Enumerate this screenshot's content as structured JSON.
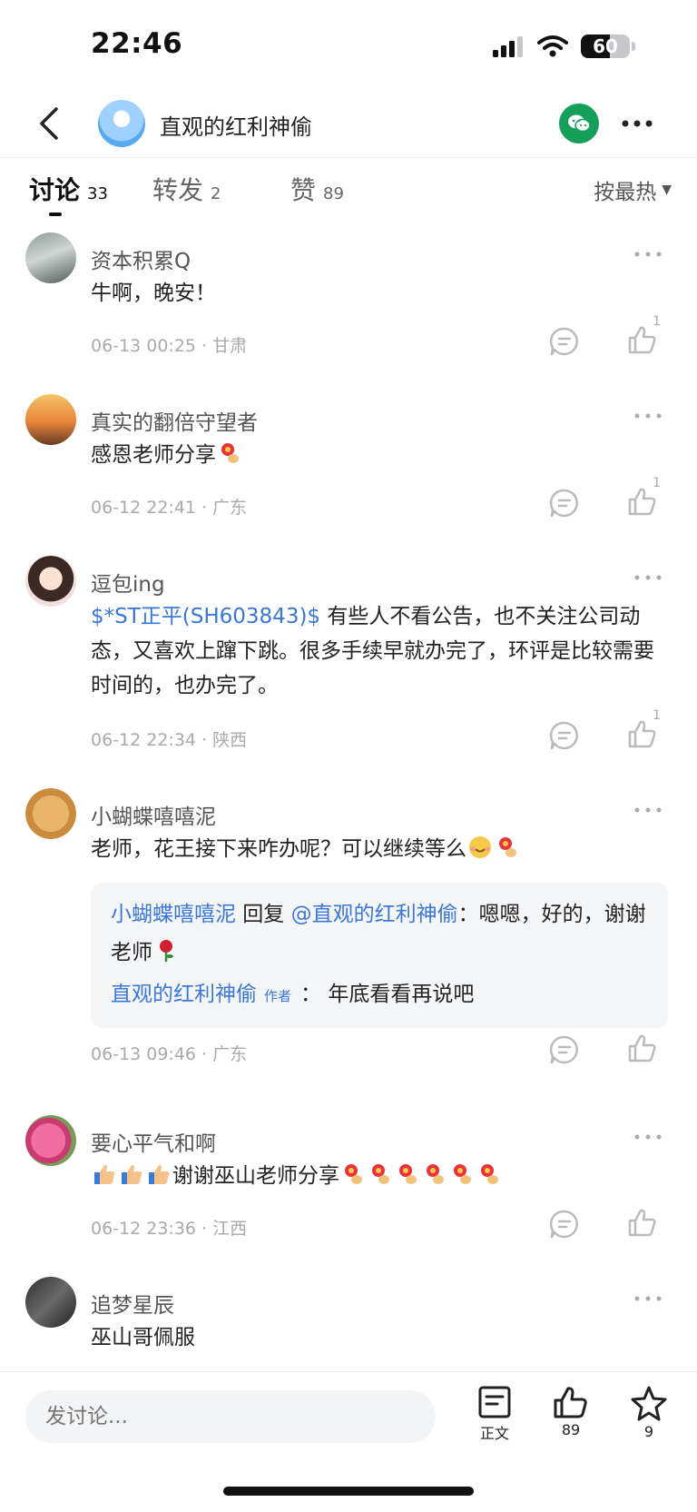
{
  "status_bar": {
    "time": "22:46",
    "battery_text": "60",
    "battery_level": 0.6
  },
  "header": {
    "title": "直观的红利神偷"
  },
  "tabs": [
    {
      "label": "讨论",
      "count": "33"
    },
    {
      "label": "转发",
      "count": "2"
    },
    {
      "label": "赞",
      "count": "89"
    }
  ],
  "sort": {
    "label": "按最热"
  },
  "comments": [
    {
      "name": "资本积累Q",
      "text": "牛啊，晚安！",
      "meta": "06-13 00:25 · 甘肃",
      "likes": "1"
    },
    {
      "name": "真实的翻倍守望者",
      "text": "感恩老师分享",
      "meta": "06-12 22:41 · 广东",
      "likes": "1"
    },
    {
      "name": "逗包ing",
      "stock_tag": "$*ST正平(SH603843)$",
      "text": " 有些人不看公告，也不关注公司动态，又喜欢上蹿下跳。很多手续早就办完了，环评是比较需要时间的，也办完了。",
      "meta": "06-12 22:34 · 陕西",
      "likes": "1"
    },
    {
      "name": "小蝴蝶嘻嘻泥",
      "text": "老师，花王接下来咋办呢？可以继续等么",
      "reply": {
        "from": "小蝴蝶嘻嘻泥",
        "verb": " 回复 ",
        "to": "@直观的红利神偷",
        "text": "：嗯嗯，好的，谢谢老师",
        "author": "直观的红利神偷",
        "author_tag": "作者",
        "author_text": "： 年底看看再说吧"
      },
      "meta": "06-13 09:46 · 广东"
    },
    {
      "name": "要心平气和啊",
      "text": "谢谢巫山老师分享",
      "meta": "06-12 23:36 · 江西"
    },
    {
      "name": "追梦星辰",
      "text": "巫山哥佩服"
    }
  ],
  "bottom_bar": {
    "input_placeholder": "发讨论...",
    "article_label": "正文",
    "like_count": "89",
    "favorite_count": "9"
  },
  "colors": {
    "link": "#3a77d8",
    "wechat": "#14a05a"
  }
}
